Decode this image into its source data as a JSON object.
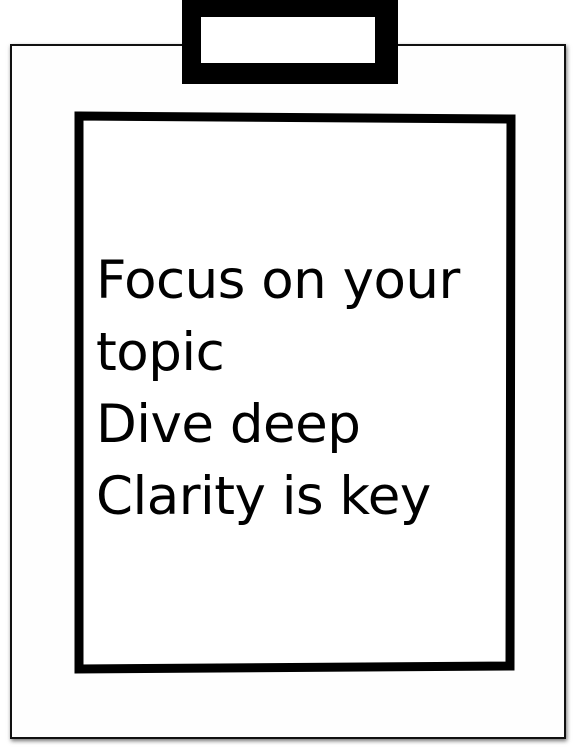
{
  "note": {
    "lines": [
      "Focus on your",
      "topic",
      "Dive deep",
      "Clarity is key"
    ]
  },
  "colors": {
    "ink": "#000000",
    "paper": "#ffffff"
  },
  "icons": {
    "clip": "clipboard-clip-icon"
  }
}
